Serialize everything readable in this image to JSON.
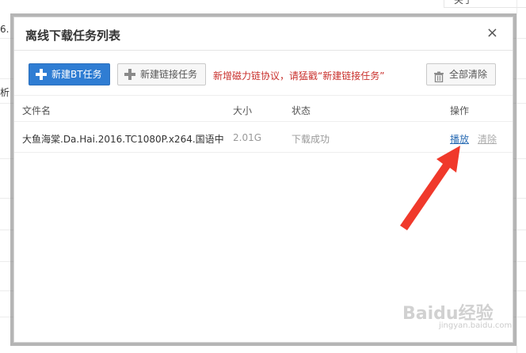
{
  "background": {
    "fragment_1": "6.",
    "fragment_2": "析",
    "fragment_top_right": "关于"
  },
  "dialog": {
    "title": "离线下载任务列表",
    "close_label": "×"
  },
  "toolbar": {
    "new_bt_label": "新建BT任务",
    "new_link_label": "新建链接任务",
    "notice": "新增磁力链协议，请猛戳“新建链接任务”",
    "clear_all_label": "全部清除"
  },
  "table": {
    "headers": {
      "name": "文件名",
      "size": "大小",
      "status": "状态",
      "actions": "操作"
    },
    "rows": [
      {
        "name": "大鱼海棠.Da.Hai.2016.TC1080P.x264.国语中…",
        "size": "2.01G",
        "status": "下载成功",
        "play": "播放",
        "remove": "清除"
      }
    ]
  },
  "watermark": {
    "text": "Baidu经验",
    "sub": "jingyan.baidu.com"
  },
  "colors": {
    "primary": "#2f7dd3",
    "notice": "#c9302c",
    "link": "#2f6fb5",
    "arrow": "#f0392b"
  }
}
